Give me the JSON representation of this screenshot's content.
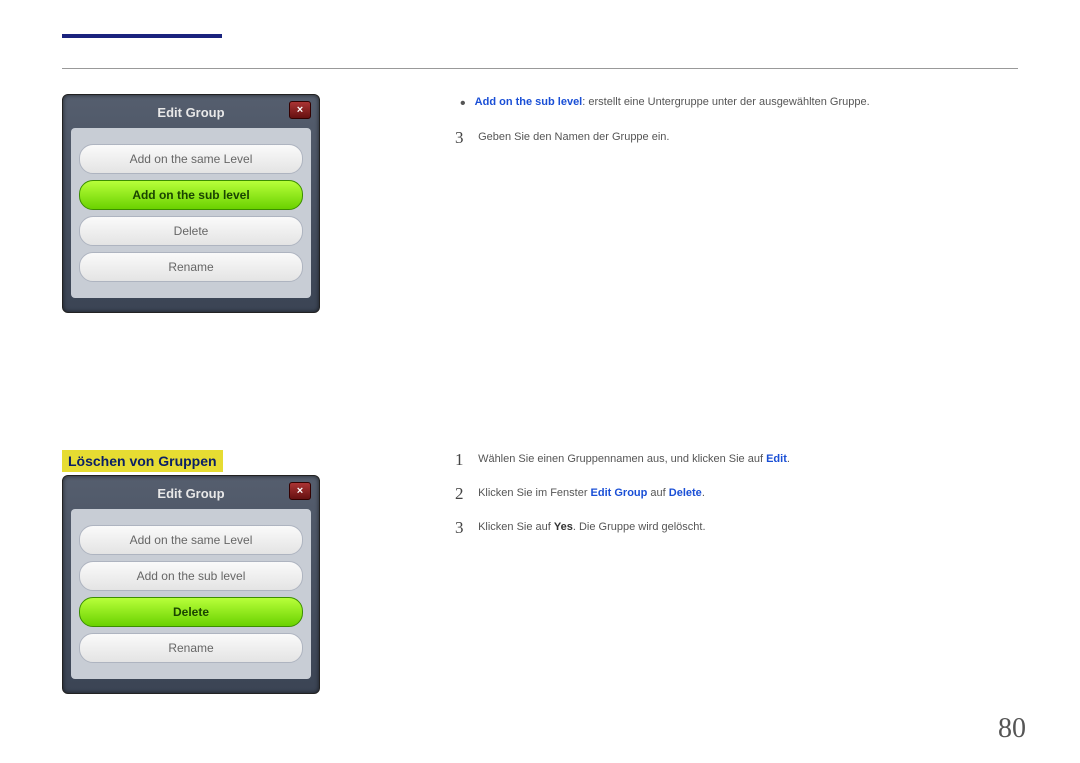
{
  "page_number": "80",
  "dialog": {
    "title": "Edit Group",
    "options": [
      "Add on the same Level",
      "Add on the sub level",
      "Delete",
      "Rename"
    ]
  },
  "heading_delete": "Löschen von Gruppen",
  "bullet": {
    "label": "Add on the sub level",
    "text": ": erstellt eine Untergruppe unter der ausgewählten Gruppe."
  },
  "step_top": {
    "num": "3",
    "text": "Geben Sie den Namen der Gruppe ein."
  },
  "steps_bottom": [
    {
      "num": "1",
      "pre": "Wählen Sie einen Gruppennamen aus, und klicken Sie auf ",
      "blue": "Edit",
      "post": "."
    },
    {
      "num": "2",
      "pre": "Klicken Sie im Fenster ",
      "blue": "Edit Group",
      "mid": " auf ",
      "blue2": "Delete",
      "post": "."
    },
    {
      "num": "3",
      "pre": "Klicken Sie auf ",
      "bold": "Yes",
      "post": ". Die Gruppe wird gelöscht."
    }
  ]
}
